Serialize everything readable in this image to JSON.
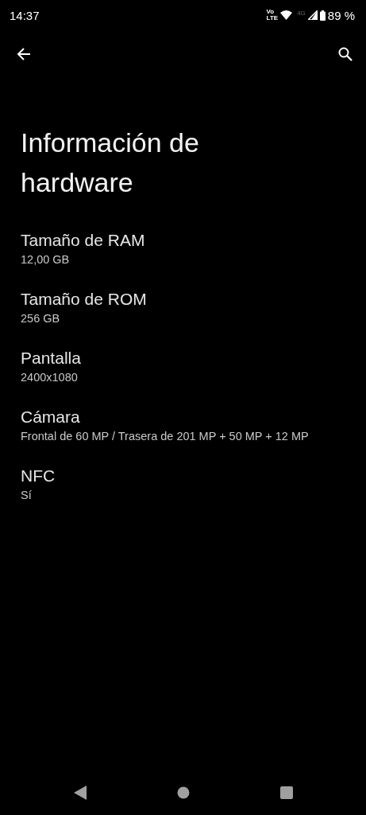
{
  "status_bar": {
    "time": "14:37",
    "volte": [
      "Vo",
      "LTE"
    ],
    "network": "4G",
    "battery": "89 %"
  },
  "title": "Información de hardware",
  "items": [
    {
      "label": "Tamaño de RAM",
      "value": "12,00 GB"
    },
    {
      "label": "Tamaño de ROM",
      "value": "256 GB"
    },
    {
      "label": "Pantalla",
      "value": "2400x1080"
    },
    {
      "label": "Cámara",
      "value": "Frontal de 60 MP / Trasera de 201 MP + 50 MP + 12 MP"
    },
    {
      "label": "NFC",
      "value": "Sí"
    }
  ]
}
